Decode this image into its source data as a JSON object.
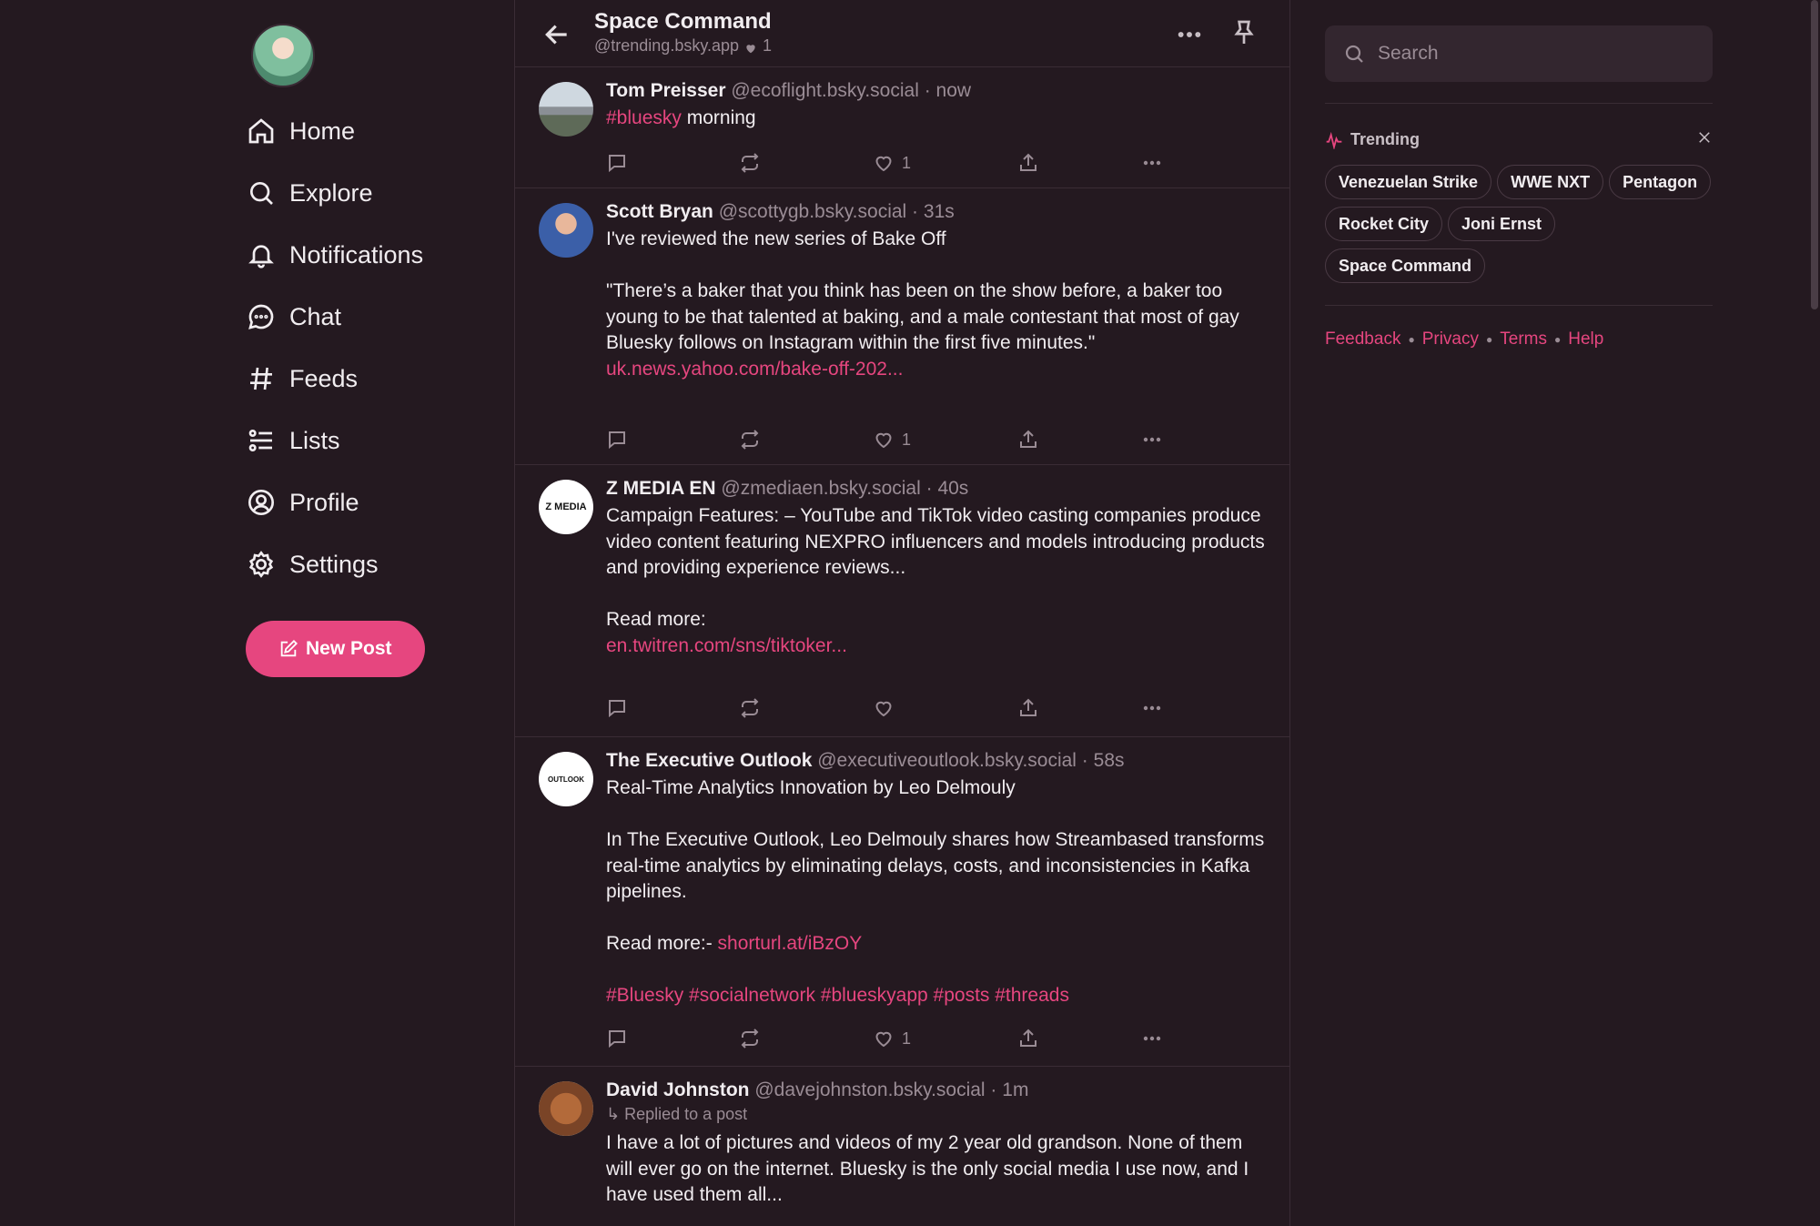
{
  "nav": {
    "items": [
      {
        "label": "Home",
        "icon": "home-icon"
      },
      {
        "label": "Explore",
        "icon": "search-icon"
      },
      {
        "label": "Notifications",
        "icon": "bell-icon"
      },
      {
        "label": "Chat",
        "icon": "chat-icon"
      },
      {
        "label": "Feeds",
        "icon": "hash-icon"
      },
      {
        "label": "Lists",
        "icon": "list-icon"
      },
      {
        "label": "Profile",
        "icon": "user-circle-icon"
      },
      {
        "label": "Settings",
        "icon": "gear-icon"
      }
    ],
    "new_post_label": "New Post"
  },
  "feed_header": {
    "title": "Space Command",
    "subtitle": "@trending.bsky.app",
    "likes": "1"
  },
  "posts": [
    {
      "name": "Tom Preisser",
      "handle": "@ecoflight.bsky.social",
      "time": "now",
      "tag": "#bluesky",
      "text": " morning",
      "likes": "1"
    },
    {
      "name": "Scott Bryan",
      "handle": "@scottygb.bsky.social",
      "time": "31s",
      "text": "I've reviewed the new series of Bake Off\n\n\"There’s a baker that you think has been on the show before, a baker too young to be that talented at baking, and a male contestant that most of gay Bluesky follows on Instagram within the first five minutes.\"\n",
      "link": "uk.news.yahoo.com/bake-off-202...",
      "likes": "1"
    },
    {
      "name": "Z MEDIA EN",
      "handle": "@zmediaen.bsky.social",
      "time": "40s",
      "avatar_text": "Z MEDIA",
      "text": "Campaign Features: – YouTube and TikTok video casting companies produce video content featuring NEXPRO influencers and models introducing products and providing experience reviews...\n\nRead more:\n",
      "link": "en.twitren.com/sns/tiktoker...",
      "likes": ""
    },
    {
      "name": "The Executive Outlook",
      "handle": "@executiveoutlook.bsky.social",
      "time": "58s",
      "avatar_text": "OUTLOOK",
      "text": "Real-Time Analytics Innovation by Leo Delmouly\n\nIn The Executive Outlook, Leo Delmouly shares how Streambased transforms real-time analytics by eliminating delays, costs, and inconsistencies in Kafka pipelines.\n\nRead more:- ",
      "link": "shorturl.at/iBzOY",
      "tags": "#Bluesky #socialnetwork #blueskyapp #posts #threads",
      "likes": "1"
    },
    {
      "name": "David Johnston",
      "handle": "@davejohnston.bsky.social",
      "time": "1m",
      "reply_note": "↳ Replied to a post",
      "text": "I have a lot of pictures and videos of my 2 year old grandson. None of them will ever go on the internet. Bluesky is the only social media I use now, and I have used them all..."
    }
  ],
  "right": {
    "search_placeholder": "Search",
    "trending_label": "Trending",
    "trends": [
      "Venezuelan Strike",
      "WWE NXT",
      "Pentagon",
      "Rocket City",
      "Joni Ernst",
      "Space Command"
    ],
    "footer": [
      "Feedback",
      "Privacy",
      "Terms",
      "Help"
    ]
  },
  "colors": {
    "background": "#241920",
    "accent": "#e6467f",
    "muted_text": "#9a8c95"
  }
}
